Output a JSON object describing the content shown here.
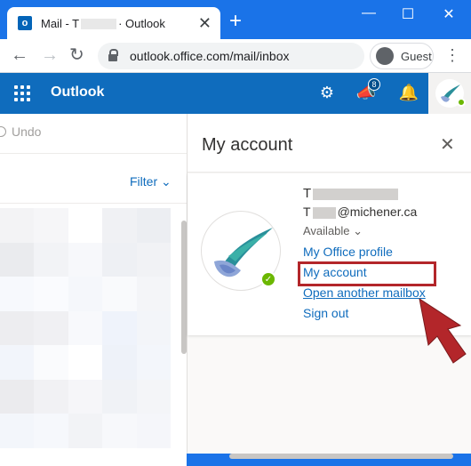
{
  "browser": {
    "tab_title_prefix": "Mail - T",
    "tab_title_suffix": "· Outlook",
    "tab_icon_letter": "o",
    "url": "outlook.office.com/mail/inbox",
    "profile_label": "Guest"
  },
  "outlook": {
    "brand": "Outlook",
    "notification_count": "8",
    "undo_label": "Undo",
    "filter_label": "Filter"
  },
  "account_panel": {
    "title": "My account",
    "name_initial": "T",
    "email_initial": "T",
    "email_domain": "@michener.ca",
    "status": "Available",
    "links": {
      "office_profile": "My Office profile",
      "my_account": "My account",
      "open_mailbox": "Open another mailbox",
      "sign_out": "Sign out"
    }
  },
  "colors": {
    "browser_accent": "#1a73e8",
    "outlook_blue": "#0f6cbd",
    "presence_green": "#6bb700",
    "highlight_red": "#b3262a"
  }
}
